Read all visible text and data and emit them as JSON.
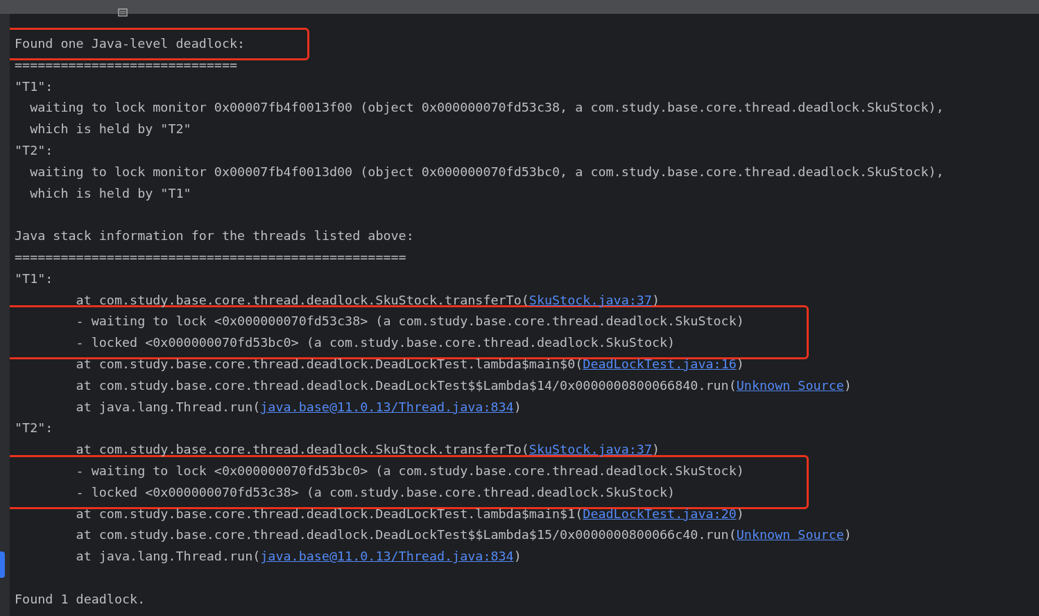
{
  "console": {
    "lines": [
      {
        "kind": "plain",
        "text": "Found one Java-level deadlock:",
        "highlighted": true
      },
      {
        "kind": "plain",
        "text": "============================="
      },
      {
        "kind": "plain",
        "text": "\"T1\":",
        "children": [
          {
            "kind": "detail",
            "text": "waiting to lock monitor 0x00007fb4f0013f00 (object 0x000000070fd53c38, a com.study.base.core.thread.deadlock.SkuStock),"
          },
          {
            "kind": "detail",
            "text": "which is held by \"T2\""
          }
        ]
      },
      {
        "kind": "plain",
        "text": "\"T2\":",
        "children": [
          {
            "kind": "detail",
            "text": "waiting to lock monitor 0x00007fb4f0013d00 (object 0x000000070fd53bc0, a com.study.base.core.thread.deadlock.SkuStock),"
          },
          {
            "kind": "detail",
            "text": "which is held by \"T1\""
          }
        ]
      },
      {
        "kind": "blank"
      },
      {
        "kind": "plain",
        "text": "Java stack information for the threads listed above:"
      },
      {
        "kind": "plain",
        "text": "==================================================="
      },
      {
        "kind": "plain",
        "text": "\"T1\":",
        "children": [
          {
            "kind": "frame",
            "text": "at com.study.base.core.thread.deadlock.SkuStock.transferTo(",
            "link": "SkuStock.java:37",
            "suffix": ")"
          },
          {
            "kind": "frame",
            "text": "- waiting to lock <0x000000070fd53c38> (a com.study.base.core.thread.deadlock.SkuStock)",
            "highlighted": true
          },
          {
            "kind": "frame",
            "text": "- locked <0x000000070fd53bc0> (a com.study.base.core.thread.deadlock.SkuStock)",
            "highlighted": true
          },
          {
            "kind": "frame",
            "text": "at com.study.base.core.thread.deadlock.DeadLockTest.lambda$main$0(",
            "link": "DeadLockTest.java:16",
            "suffix": ")"
          },
          {
            "kind": "frame",
            "text": "at com.study.base.core.thread.deadlock.DeadLockTest$$Lambda$14/0x0000000800066840.run(",
            "link": "Unknown Source",
            "suffix": ")"
          },
          {
            "kind": "frame",
            "text": "at java.lang.Thread.run(",
            "link": "java.base@11.0.13/Thread.java:834",
            "suffix": ")"
          }
        ]
      },
      {
        "kind": "plain",
        "text": "\"T2\":",
        "children": [
          {
            "kind": "frame",
            "text": "at com.study.base.core.thread.deadlock.SkuStock.transferTo(",
            "link": "SkuStock.java:37",
            "suffix": ")"
          },
          {
            "kind": "frame",
            "text": "- waiting to lock <0x000000070fd53bc0> (a com.study.base.core.thread.deadlock.SkuStock)",
            "highlighted": true
          },
          {
            "kind": "frame",
            "text": "- locked <0x000000070fd53c38> (a com.study.base.core.thread.deadlock.SkuStock)",
            "highlighted": true
          },
          {
            "kind": "frame",
            "text": "at com.study.base.core.thread.deadlock.DeadLockTest.lambda$main$1(",
            "link": "DeadLockTest.java:20",
            "suffix": ")"
          },
          {
            "kind": "frame",
            "text": "at com.study.base.core.thread.deadlock.DeadLockTest$$Lambda$15/0x0000000800066c40.run(",
            "link": "Unknown Source",
            "suffix": ")"
          },
          {
            "kind": "frame",
            "text": "at java.lang.Thread.run(",
            "link": "java.base@11.0.13/Thread.java:834",
            "suffix": ")"
          }
        ]
      },
      {
        "kind": "blank"
      },
      {
        "kind": "plain",
        "text": "Found 1 deadlock."
      }
    ]
  }
}
